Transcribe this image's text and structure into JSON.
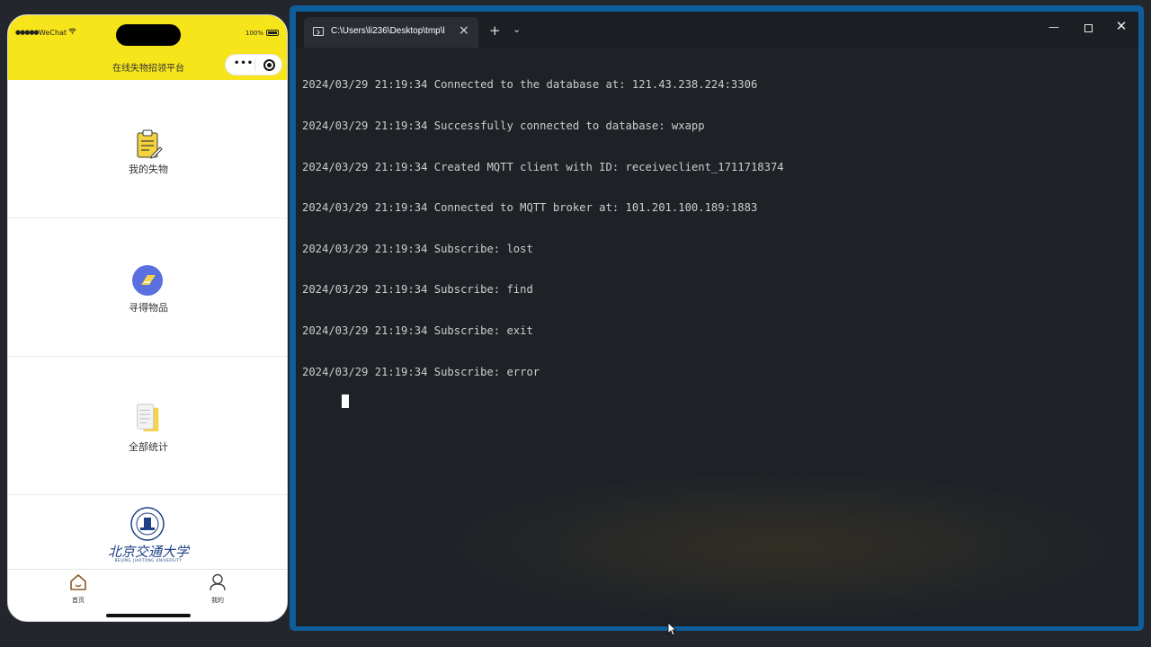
{
  "phone": {
    "status": {
      "signal": "●●●●●",
      "carrier": "WeChat",
      "wifi_icon": "wifi-icon",
      "battery_pct": "100%"
    },
    "title": "在线失物招领平台",
    "capsule": {
      "more": "•••"
    },
    "menu_items": [
      {
        "label": "我的失物",
        "icon": "clipboard-icon"
      },
      {
        "label": "寻得物品",
        "icon": "found-item-icon"
      },
      {
        "label": "全部统计",
        "icon": "document-stack-icon"
      }
    ],
    "logo": {
      "text": "北京交通大学",
      "sub": "BEIJING JIAOTONG UNIVERSITY"
    },
    "tabbar": [
      {
        "label": "首页",
        "icon": "home-icon"
      },
      {
        "label": "我的",
        "icon": "user-icon"
      }
    ]
  },
  "terminal": {
    "tab_title": "C:\\Users\\li236\\Desktop\\tmp\\l",
    "new_tab": "+",
    "dropdown": "⌄",
    "close_tab": "×",
    "window_controls": {
      "minimize": "—",
      "close": "✕"
    },
    "lines": [
      "2024/03/29 21:19:34 Connected to the database at: 121.43.238.224:3306",
      "2024/03/29 21:19:34 Successfully connected to database: wxapp",
      "2024/03/29 21:19:34 Created MQTT client with ID: receiveclient_1711718374",
      "2024/03/29 21:19:34 Connected to MQTT broker at: 101.201.100.189:1883",
      "2024/03/29 21:19:34 Subscribe: lost",
      "2024/03/29 21:19:34 Subscribe: find",
      "2024/03/29 21:19:34 Subscribe: exit",
      "2024/03/29 21:19:34 Subscribe: error"
    ]
  },
  "colors": {
    "phone_header": "#f7e51b",
    "terminal_border": "#0e5e9c",
    "terminal_bg": "#1e2227",
    "console_text": "#cccccc"
  }
}
